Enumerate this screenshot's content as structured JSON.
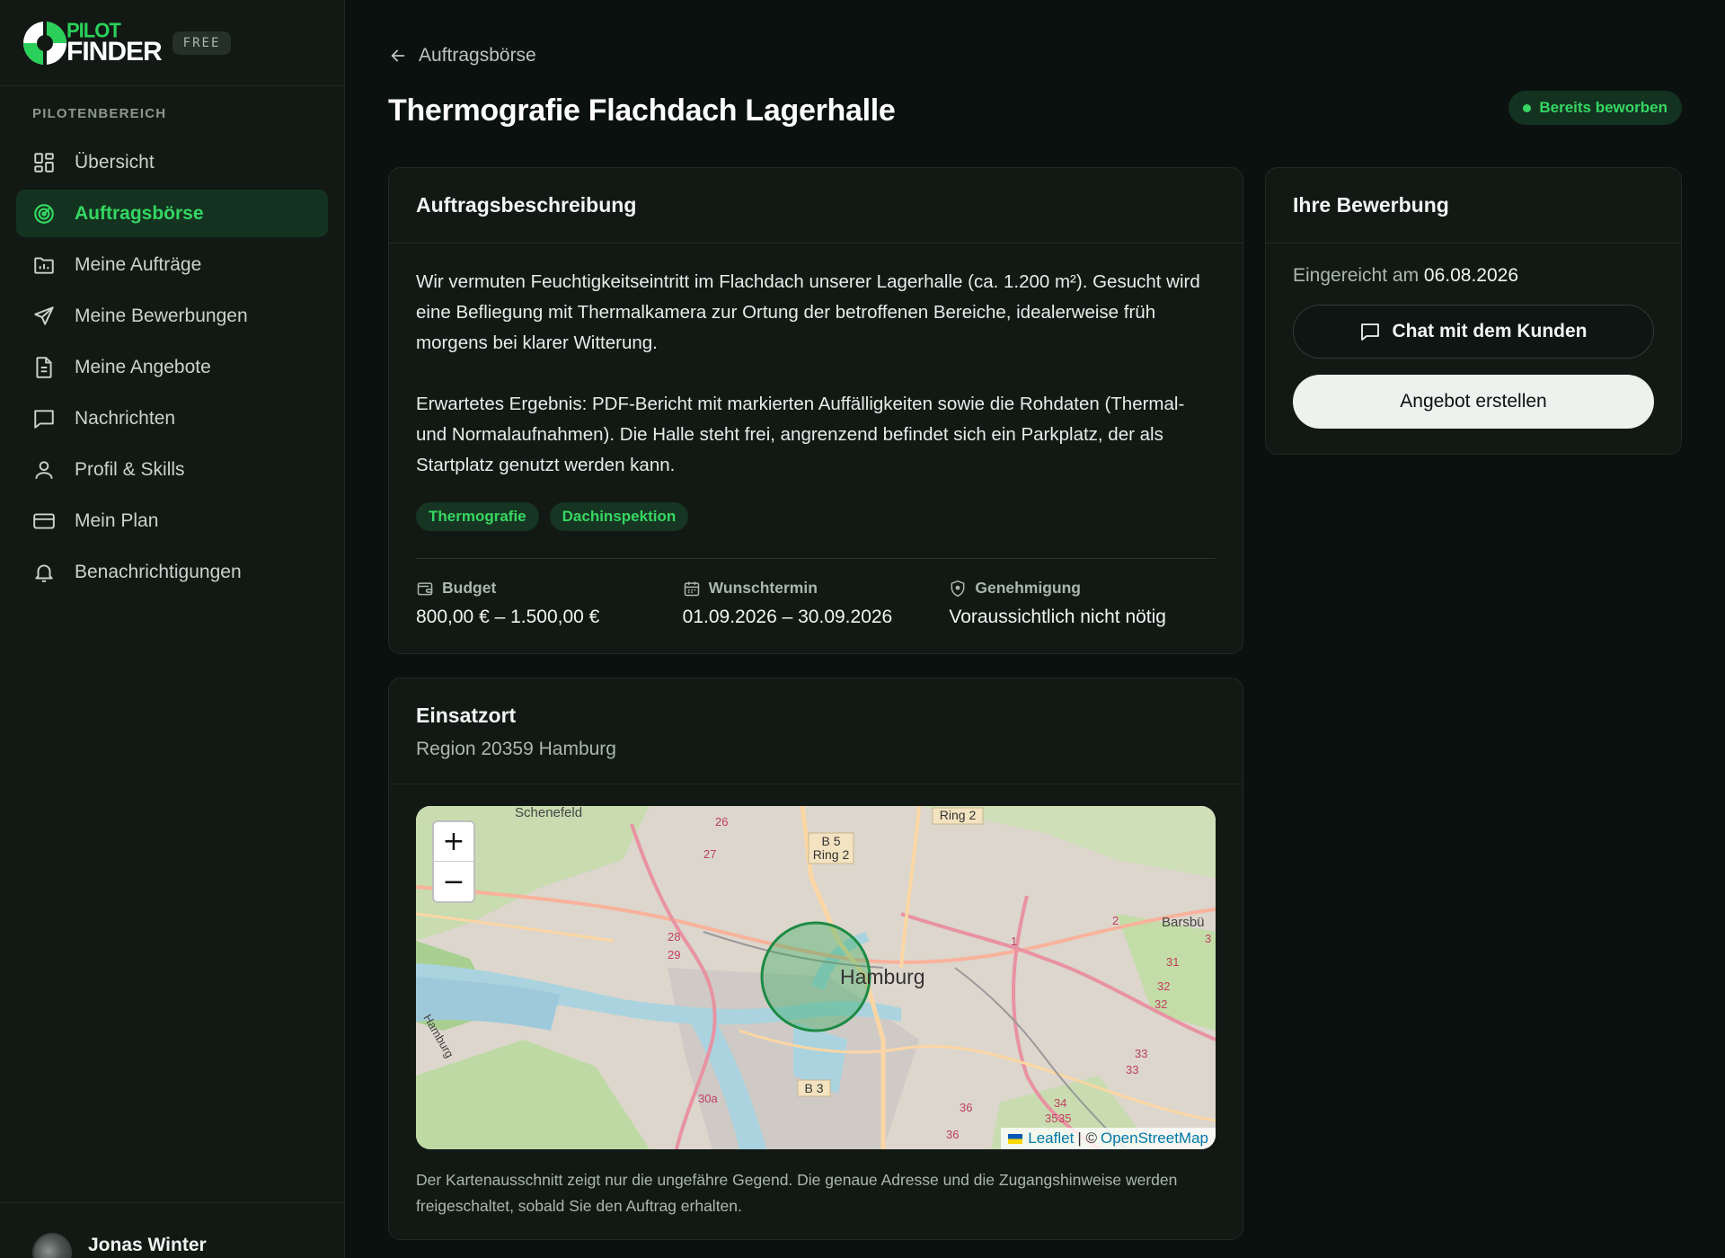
{
  "brand": {
    "logo_line1": "PILOT",
    "logo_line2": "FINDER",
    "plan_badge": "FREE"
  },
  "sidebar": {
    "section_label": "PILOTENBEREICH",
    "items": [
      {
        "label": "Übersicht",
        "icon": "dashboard-grid-icon"
      },
      {
        "label": "Auftragsbörse",
        "icon": "radar-icon",
        "active": true
      },
      {
        "label": "Meine Aufträge",
        "icon": "folder-chart-icon"
      },
      {
        "label": "Meine Bewerbungen",
        "icon": "send-icon"
      },
      {
        "label": "Meine Angebote",
        "icon": "document-icon"
      },
      {
        "label": "Nachrichten",
        "icon": "chat-bubble-icon"
      },
      {
        "label": "Profil & Skills",
        "icon": "user-icon"
      },
      {
        "label": "Mein Plan",
        "icon": "credit-card-icon"
      },
      {
        "label": "Benachrichtigungen",
        "icon": "bell-icon"
      }
    ],
    "user_name": "Jonas Winter"
  },
  "header": {
    "back_label": "Auftragsbörse",
    "title": "Thermografie Flachdach Lagerhalle",
    "status": "Bereits beworben"
  },
  "description": {
    "title": "Auftragsbeschreibung",
    "paragraph1": "Wir vermuten Feuchtigkeitseintritt im Flachdach unserer Lagerhalle (ca. 1.200 m²). Gesucht wird eine Befliegung mit Thermalkamera zur Ortung der betroffenen Bereiche, idealerweise früh morgens bei klarer Witterung.",
    "paragraph2": "Erwartetes Ergebnis: PDF-Bericht mit markierten Auffälligkeiten sowie die Rohdaten (Thermal- und Normalaufnahmen). Die Halle steht frei, angrenzend befindet sich ein Parkplatz, der als Startplatz genutzt werden kann.",
    "tags": [
      "Thermografie",
      "Dachinspektion"
    ],
    "facts": [
      {
        "label": "Budget",
        "value": "800,00 € – 1.500,00 €",
        "icon": "wallet-icon"
      },
      {
        "label": "Wunschtermin",
        "value": "01.09.2026 – 30.09.2026",
        "icon": "calendar-icon"
      },
      {
        "label": "Genehmigung",
        "value": "Voraussichtlich nicht nötig",
        "icon": "shield-icon"
      }
    ]
  },
  "application": {
    "title": "Ihre Bewerbung",
    "submitted_prefix": "Eingereicht am",
    "submitted_date": "06.08.2026",
    "chat_button": "Chat mit dem Kunden",
    "offer_button": "Angebot erstellen"
  },
  "location": {
    "title": "Einsatzort",
    "region": "Region 20359 Hamburg",
    "map": {
      "zoom_in": "+",
      "zoom_out": "−",
      "city_label": "Hamburg",
      "place_labels": [
        "Schenefeld",
        "Barsbü",
        "Hamburg"
      ],
      "road_labels": [
        "Ring 2",
        "B 5",
        "Ring 2",
        "B 3",
        "26",
        "27",
        "28",
        "29",
        "30a",
        "31",
        "32",
        "32",
        "33",
        "33",
        "34",
        "35",
        "35",
        "36",
        "36",
        "2",
        "1",
        "3"
      ],
      "attribution_leaflet": "Leaflet",
      "attribution_sep": "| ©",
      "attribution_osm": "OpenStreetMap"
    },
    "note": "Der Kartenausschnitt zeigt nur die ungefähre Gegend. Die genaue Adresse und die Zugangshinweise werden freigeschaltet, sobald Sie den Auftrag erhalten."
  },
  "colors": {
    "accent": "#35d662",
    "background": "#0b110e",
    "card": "#121915"
  }
}
